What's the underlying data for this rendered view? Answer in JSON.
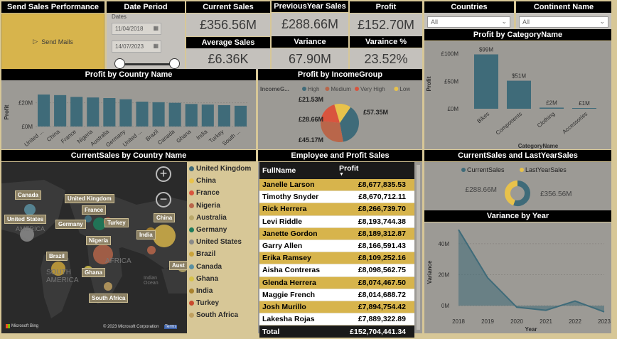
{
  "send_sales": {
    "title": "Send Sales Performance",
    "button": "Send Mails",
    "icon": "play-icon"
  },
  "date_period": {
    "title": "Date Period",
    "subtitle": "Dates",
    "start": "11/04/2018",
    "end": "14/07/2023"
  },
  "kpis": {
    "current_sales": {
      "label": "Current Sales",
      "value": "£356.56M"
    },
    "previous_year_sales": {
      "label": "PreviousYear Sales",
      "value": "£288.66M"
    },
    "profit": {
      "label": "Profit",
      "value": "£152.70M"
    },
    "average_sales": {
      "label": "Average Sales",
      "value": "£6.36K"
    },
    "variance": {
      "label": "Variance",
      "value": "67.90M"
    },
    "variance_pct": {
      "label": "Varaince %",
      "value": "23.52%"
    }
  },
  "filters": {
    "countries": {
      "label": "Countries",
      "value": "All"
    },
    "continent": {
      "label": "Continent Name",
      "value": "All"
    }
  },
  "profit_by_country": {
    "title": "Profit by Country Name",
    "chart_data": {
      "type": "bar",
      "ylabel": "Profit",
      "ylim": [
        0,
        30
      ],
      "ticks": [
        "£20M",
        "£0M"
      ],
      "categories": [
        "United ...",
        "China",
        "France",
        "Nigeria",
        "Australia",
        "Germany",
        "United ...",
        "Brazil",
        "Canada",
        "Ghana",
        "India",
        "Turkey",
        "South ..."
      ],
      "values": [
        27,
        26.5,
        25,
        24.5,
        24,
        23,
        21,
        20.5,
        20,
        19,
        18.5,
        18,
        17.5
      ]
    }
  },
  "profit_by_income": {
    "title": "Profit by IncomeGroup",
    "legend_title": "IncomeG...",
    "chart_data": {
      "type": "pie",
      "series": [
        {
          "name": "High",
          "value": 57.35,
          "label": "£57.35M",
          "color": "#3f6b79"
        },
        {
          "name": "Medium",
          "value": 45.17,
          "label": "£45.17M",
          "color": "#b9664a"
        },
        {
          "name": "Very High",
          "value": 28.66,
          "label": "£28.66M",
          "color": "#d9543e"
        },
        {
          "name": "Low",
          "value": 21.53,
          "label": "£21.53M",
          "color": "#e8c24b"
        }
      ]
    }
  },
  "profit_by_category": {
    "title": "Profit by CategoryName",
    "chart_data": {
      "type": "bar",
      "xlabel": "CategoryName",
      "ylabel": "Profit",
      "ylim": [
        0,
        110
      ],
      "ticks": [
        "£100M",
        "£50M",
        "£0M"
      ],
      "categories": [
        "Bikes",
        "Components",
        "Clothing",
        "Accessories"
      ],
      "values": [
        99,
        51,
        2,
        1
      ],
      "labels": [
        "$99M",
        "$51M",
        "£2M",
        "£1M"
      ]
    }
  },
  "map": {
    "title": "CurrentSales by Country Name",
    "labels": [
      "Canada",
      "United States",
      "AMERICA",
      "Germany",
      "France",
      "United Kingdom",
      "Turkey",
      "Nigeria",
      "China",
      "India",
      "Brazil",
      "Ghana",
      "SOUTH AMERICA",
      "South Africa",
      "Aust",
      "AFRICA",
      "Indian Ocean"
    ],
    "footer_left": "Microsoft Bing",
    "footer_right": "© 2023 Microsoft Corporation",
    "footer_terms": "Terms",
    "zoom_in": "+",
    "zoom_out": "−",
    "legend": [
      {
        "name": "United Kingdom",
        "color": "#3f6b79"
      },
      {
        "name": "China",
        "color": "#e8c24b"
      },
      {
        "name": "France",
        "color": "#d9543e"
      },
      {
        "name": "Nigeria",
        "color": "#b9664a"
      },
      {
        "name": "Australia",
        "color": "#b9a86a"
      },
      {
        "name": "Germany",
        "color": "#1f7a5a"
      },
      {
        "name": "United States",
        "color": "#8a8a8a"
      },
      {
        "name": "Brazil",
        "color": "#c9a23a"
      },
      {
        "name": "Canada",
        "color": "#5a8fa0"
      },
      {
        "name": "Ghana",
        "color": "#d6c24a"
      },
      {
        "name": "India",
        "color": "#a9822e"
      },
      {
        "name": "Turkey",
        "color": "#c84a2e"
      },
      {
        "name": "South Africa",
        "color": "#c0a060"
      }
    ]
  },
  "employee": {
    "title": "Employee and Profit Sales",
    "headers": [
      "FullName",
      "Profit"
    ],
    "rows": [
      [
        "Janelle Larson",
        "£8,677,835.53"
      ],
      [
        "Timothy Snyder",
        "£8,670,712.11"
      ],
      [
        "Rick Herrera",
        "£8,266,739.70"
      ],
      [
        "Levi Riddle",
        "£8,193,744.38"
      ],
      [
        "Janette Gordon",
        "£8,189,312.87"
      ],
      [
        "Garry Allen",
        "£8,166,591.43"
      ],
      [
        "Erika Ramsey",
        "£8,109,252.16"
      ],
      [
        "Aisha Contreras",
        "£8,098,562.75"
      ],
      [
        "Glenda Herrera",
        "£8,074,467.50"
      ],
      [
        "Maggie French",
        "£8,014,688.72"
      ],
      [
        "Josh Murillo",
        "£7,894,754.42"
      ],
      [
        "Lakesha Rojas",
        "£7,889,322.89"
      ]
    ],
    "total_label": "Total",
    "total_value": "£152,704,441.34"
  },
  "current_vs_last": {
    "title": "CurrentSales and LastYearSales",
    "chart_data": {
      "type": "pie",
      "series": [
        {
          "name": "CurrentSales",
          "value": 356.56,
          "label": "£356.56M",
          "color": "#3f6b79"
        },
        {
          "name": "LastYearSales",
          "value": 288.66,
          "label": "£288.66M",
          "color": "#e8c24b"
        }
      ]
    }
  },
  "variance_by_year": {
    "title": "Variance by Year",
    "chart_data": {
      "type": "area",
      "xlabel": "Year",
      "ylabel": "Variance",
      "ylim": [
        -5,
        50
      ],
      "ticks": [
        "40M",
        "20M",
        "0M"
      ],
      "x": [
        "2018",
        "2019",
        "2020",
        "2021",
        "2022",
        "2023"
      ],
      "values": [
        49,
        18,
        -1,
        -3,
        3,
        -4
      ]
    }
  }
}
